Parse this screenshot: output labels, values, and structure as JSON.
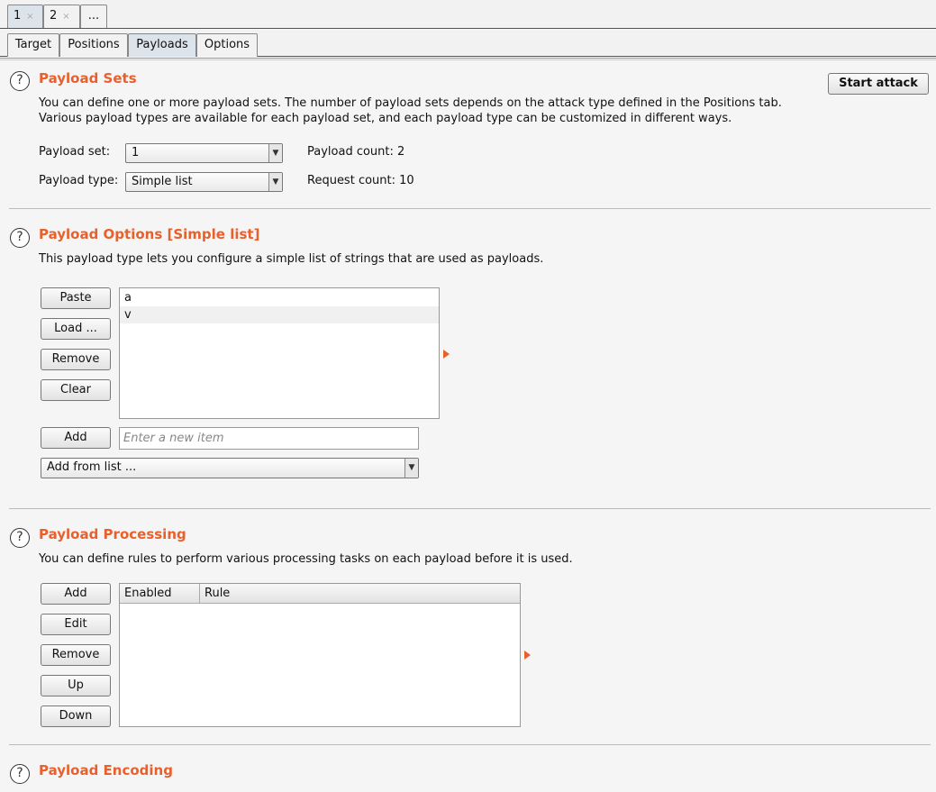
{
  "attack_tabs": [
    {
      "label": "1",
      "close": "×"
    },
    {
      "label": "2",
      "close": "×"
    },
    {
      "label": "..."
    }
  ],
  "section_tabs": [
    "Target",
    "Positions",
    "Payloads",
    "Options"
  ],
  "help_glyph": "?",
  "payload_sets": {
    "title": "Payload Sets",
    "desc_line1": "You can define one or more payload sets. The number of payload sets depends on the attack type defined in the Positions tab.",
    "desc_line2": "Various payload types are available for each payload set, and each payload type can be customized in different ways.",
    "start_attack_label": "Start attack",
    "payload_set_label": "Payload set:",
    "payload_set_value": "1",
    "payload_type_label": "Payload type:",
    "payload_type_value": "Simple list",
    "payload_count_label": "Payload count:",
    "payload_count_value": "2",
    "request_count_label": "Request count:",
    "request_count_value": "10"
  },
  "payload_options": {
    "title": "Payload Options [Simple list]",
    "desc": "This payload type lets you configure a simple list of strings that are used as payloads.",
    "buttons": {
      "paste": "Paste",
      "load": "Load ...",
      "remove": "Remove",
      "clear": "Clear",
      "add": "Add"
    },
    "items": [
      "a",
      "v"
    ],
    "new_item_placeholder": "Enter a new item",
    "add_from_list_label": "Add from list ..."
  },
  "payload_processing": {
    "title": "Payload Processing",
    "desc": "You can define rules to perform various processing tasks on each payload before it is used.",
    "buttons": {
      "add": "Add",
      "edit": "Edit",
      "remove": "Remove",
      "up": "Up",
      "down": "Down"
    },
    "columns": [
      "Enabled",
      "Rule"
    ]
  },
  "payload_encoding": {
    "title": "Payload Encoding"
  },
  "colors": {
    "accent": "#e8602c"
  }
}
